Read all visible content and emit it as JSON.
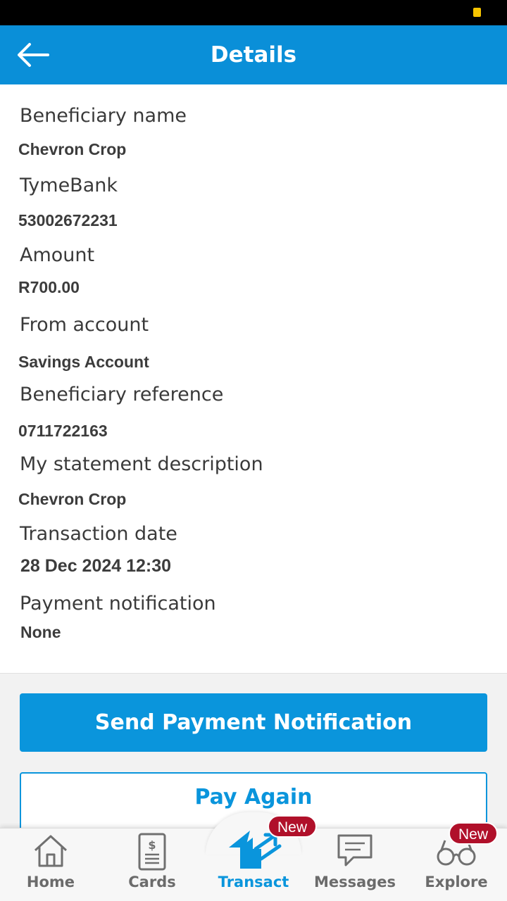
{
  "header": {
    "title": "Details",
    "back_icon": "arrow-left-icon"
  },
  "details": [
    {
      "label": "Beneficiary name",
      "value": "Chevron Crop"
    },
    {
      "label": "TymeBank",
      "value": "53002672231"
    },
    {
      "label": "Amount",
      "value": "R700.00"
    },
    {
      "label": "From account",
      "value": "Savings Account"
    },
    {
      "label": "Beneficiary reference",
      "value": "0711722163"
    },
    {
      "label": "My statement description",
      "value": "Chevron Crop"
    },
    {
      "label": "Transaction date",
      "value": "28 Dec 2024 12:30"
    },
    {
      "label": "Payment notification",
      "value": "None"
    }
  ],
  "actions": {
    "primary_label": "Send Payment Notification",
    "secondary_label": "Pay Again"
  },
  "nav": {
    "items": [
      {
        "label": "Home",
        "icon": "home-icon",
        "active": false
      },
      {
        "label": "Cards",
        "icon": "card-icon",
        "active": false
      },
      {
        "label": "Transact",
        "icon": "transact-icon",
        "active": true,
        "badge": "New"
      },
      {
        "label": "Messages",
        "icon": "message-icon",
        "active": false
      },
      {
        "label": "Explore",
        "icon": "binoculars-icon",
        "active": false,
        "badge": "New"
      }
    ]
  },
  "colors": {
    "brand": "#0a8fd8",
    "button": "#0a95dc",
    "badge": "#b0102a"
  }
}
